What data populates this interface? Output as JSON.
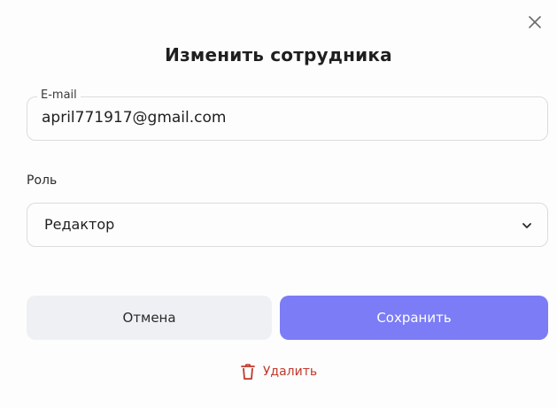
{
  "dialog": {
    "title": "Изменить сотрудника",
    "close_icon": "close-icon"
  },
  "email": {
    "label": "E-mail",
    "value": "april771917@gmail.com"
  },
  "role": {
    "label": "Роль",
    "selected": "Редактор",
    "chevron_icon": "chevron-down-icon"
  },
  "actions": {
    "cancel_label": "Отмена",
    "save_label": "Сохранить",
    "delete_label": "Удалить",
    "delete_icon": "trash-icon"
  },
  "colors": {
    "accent": "#7b7cf6",
    "cancel_bg": "#eef0f4",
    "danger": "#c0392b",
    "border": "#dcdcdc"
  }
}
